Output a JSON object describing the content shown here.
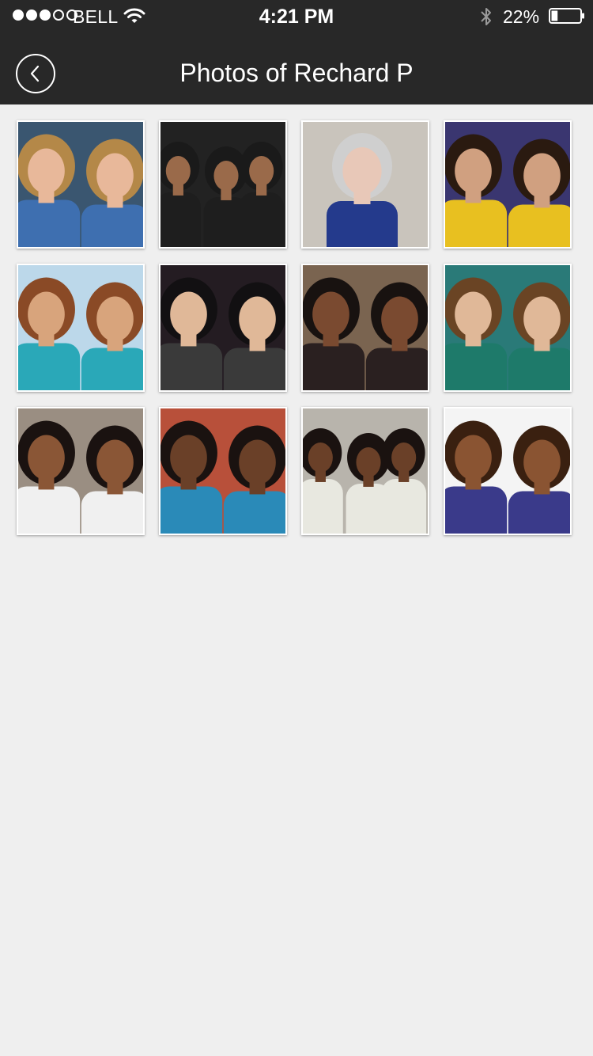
{
  "status_bar": {
    "carrier": "BELL",
    "time": "4:21 PM",
    "battery_percent": "22%",
    "battery_level": 0.22,
    "signal_strength": 3,
    "icons": [
      "signal-dots-icon",
      "wifi-icon",
      "bluetooth-icon",
      "battery-icon"
    ]
  },
  "nav": {
    "title": "Photos of Rechard P",
    "back_icon": "chevron-left-icon"
  },
  "photos": [
    {
      "bg": "#3a5670",
      "skin": "#e8b89a",
      "hair": "#b48848",
      "shirt": "#3e6fb0",
      "people": 2
    },
    {
      "bg": "#222222",
      "skin": "#9a6a4a",
      "hair": "#1a1a1a",
      "shirt": "#1e1e1e",
      "people": 3
    },
    {
      "bg": "#c9c4bc",
      "skin": "#e8c8b8",
      "hair": "#cfcfcf",
      "shirt": "#243a8c",
      "people": 1
    },
    {
      "bg": "#3a3670",
      "skin": "#d0a080",
      "hair": "#2a1a10",
      "shirt": "#e8c020",
      "people": 2
    },
    {
      "bg": "#bcd8ea",
      "skin": "#d8a47c",
      "hair": "#8a4a26",
      "shirt": "#2aa8b8",
      "people": 2
    },
    {
      "bg": "#241c22",
      "skin": "#e0b898",
      "hair": "#121012",
      "shirt": "#3a3a3a",
      "people": 2
    },
    {
      "bg": "#7a6450",
      "skin": "#7a4a30",
      "hair": "#181210",
      "shirt": "#2a2020",
      "people": 2
    },
    {
      "bg": "#2a7a78",
      "skin": "#e0b898",
      "hair": "#6a4424",
      "shirt": "#1e7a6a",
      "people": 2
    },
    {
      "bg": "#9a8e82",
      "skin": "#8a5636",
      "hair": "#1a1210",
      "shirt": "#f0f0f0",
      "people": 2
    },
    {
      "bg": "#b8503a",
      "skin": "#6a4028",
      "hair": "#1a1210",
      "shirt": "#2a8ab8",
      "people": 2
    },
    {
      "bg": "#b8b4ac",
      "skin": "#6a4028",
      "hair": "#1a1210",
      "shirt": "#e8e8e0",
      "people": 3
    },
    {
      "bg": "#f4f4f4",
      "skin": "#8a5432",
      "hair": "#3a2010",
      "shirt": "#3a3a8a",
      "people": 2
    }
  ]
}
